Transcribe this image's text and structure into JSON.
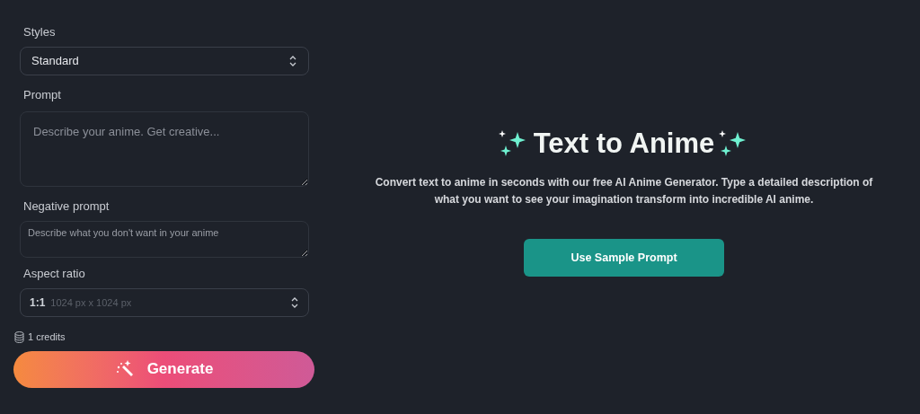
{
  "form": {
    "styles": {
      "label": "Styles",
      "value": "Standard"
    },
    "prompt": {
      "label": "Prompt",
      "placeholder": "Describe your anime. Get creative..."
    },
    "negative_prompt": {
      "label": "Negative prompt",
      "placeholder": "Describe what you don't want in your anime"
    },
    "aspect_ratio": {
      "label": "Aspect ratio",
      "value": "1:1",
      "detail": "1024 px x 1024 px"
    },
    "credits": "1 credits",
    "generate_button": "Generate"
  },
  "hero": {
    "title": "Text to Anime",
    "description": "Convert text to anime in seconds with our free AI Anime Generator. Type a detailed description of what you want to see your imagination transform into incredible AI anime.",
    "button": "Use Sample Prompt"
  }
}
